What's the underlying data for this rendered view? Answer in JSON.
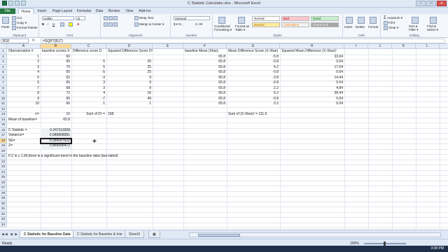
{
  "window": {
    "title": "C Statistic Calculator.xlsx - Microsoft Excel"
  },
  "ribbon_tabs": [
    "File",
    "Home",
    "Insert",
    "Page Layout",
    "Formulas",
    "Data",
    "Review",
    "View",
    "Add-Ins"
  ],
  "ribbon": {
    "clipboard": {
      "cut": "Cut",
      "copy": "Copy ▾",
      "format_painter": "Format Painter",
      "paste": "Paste",
      "label": "Clipboard"
    },
    "font": {
      "font_name": "Calibri",
      "font_size": "11",
      "label": "Font"
    },
    "alignment": {
      "wrap_text": "Wrap Text",
      "merge_center": "Merge & Center ▾",
      "label": "Alignment"
    },
    "number": {
      "format": "General",
      "label": "Number"
    },
    "styles": {
      "conditional_formatting": "Conditional Formatting ▾",
      "format_as_table": "Format as Table ▾",
      "normal": "Normal",
      "bad": "Bad",
      "good": "Good",
      "neutral": "Neutral",
      "calculation": "Calculation",
      "check_cell": "Check Cell",
      "label": "Styles"
    },
    "cells": {
      "insert": "Insert",
      "delete": "Delete",
      "format": "Format",
      "label": "Cells"
    },
    "editing": {
      "autosum": "AutoSum ▾",
      "fill": "Fill ▾",
      "clear": "Clear ▾",
      "sort_filter": "Sort & Filter ▾",
      "find_select": "Find & Select ▾",
      "label": "Editing"
    }
  },
  "formula_bar": {
    "name_box": "B18",
    "fx": "fx",
    "formula": "=SQRT(B17)"
  },
  "columns": [
    "A",
    "B",
    "C",
    "D",
    "E",
    "F",
    "G",
    "H",
    "I",
    "J",
    "K",
    "L",
    "M",
    "N"
  ],
  "rows": [
    "1",
    "2",
    "3",
    "4",
    "5",
    "6",
    "7",
    "8",
    "9",
    "10",
    "11",
    "12",
    "13",
    "14",
    "15",
    "16",
    "17",
    "18",
    "19",
    "20",
    "21",
    "22",
    "23",
    "24",
    "25",
    "26",
    "27",
    "28",
    "29",
    "30",
    "31",
    "32",
    "33",
    "34"
  ],
  "cells": {
    "a1": "Oberservation #",
    "b1": "baseline scores X",
    "c1": "Difference score D",
    "d1": "Squared Difference Score D²",
    "f1": "baseline Mean (Xbar)",
    "g1": "Mean Difference Score (X-Xbar)",
    "h1": "Squared Mean Difference (X-Xbar)²",
    "obs": [
      "1",
      "2",
      "3",
      "4",
      "5",
      "6",
      "7",
      "8",
      "9",
      "10"
    ],
    "baseline": [
      "60",
      "65",
      "70",
      "65",
      "62",
      "65",
      "68",
      "72",
      "65",
      "66"
    ],
    "diff": [
      "",
      "5",
      "5",
      "-5",
      "-3",
      "3",
      "3",
      "4",
      "-7",
      "1"
    ],
    "sqdiff": [
      "",
      "25",
      "25",
      "25",
      "9",
      "9",
      "9",
      "16",
      "49",
      "1"
    ],
    "xbar": [
      "65.8",
      "65.8",
      "65.8",
      "65.8",
      "65.8",
      "65.8",
      "65.8",
      "65.8",
      "65.8",
      "65.8"
    ],
    "meandiff": [
      "-5.8",
      "-0.8",
      "4.2",
      "-0.8",
      "-3.8",
      "-0.8",
      "2.2",
      "6.2",
      "-0.8",
      "0.2"
    ],
    "sqmeandiff": [
      "33.64",
      "0.64",
      "17.64",
      "0.64",
      "14.44",
      "0.64",
      "4.84",
      "38.44",
      "0.64",
      "0.04"
    ],
    "a13": "n=",
    "b13": "10",
    "c13": "Sum of D² =",
    "d13": "168",
    "g13": "Sum of (X-Xbar)² = 111.6",
    "a14": "Mean of baseline=",
    "b14": "65.8",
    "a16": "C Statistic =",
    "b16": "0.247311828",
    "a17": "Variance=",
    "b17": "0.080808081",
    "a18": "SE=",
    "b18": "0.284267622",
    "a19": "Z=",
    "b19": "0.869996472",
    "a21": "If Z is ≥ 1.96,there is a significant trend in the baseline data (two-tailed)"
  },
  "sheet_tabs": [
    "C Statistic for Baseline Data",
    "C Statistic for Baseline & Inte",
    "Sheet3"
  ],
  "status": {
    "ready": "Ready",
    "zoom": "100%",
    "clock": "3:08 PM"
  }
}
